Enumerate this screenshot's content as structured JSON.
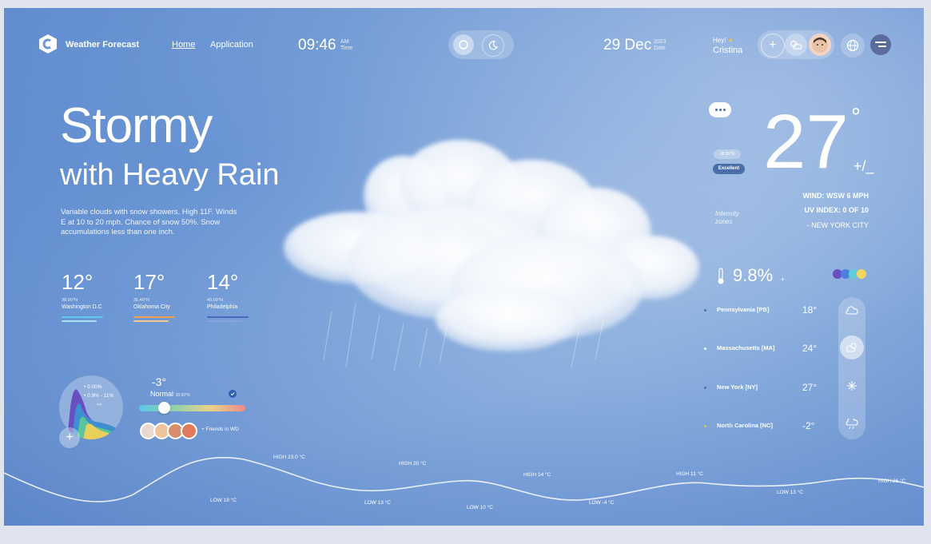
{
  "header": {
    "brand": "Weather Forecast",
    "nav": [
      "Home",
      "Application"
    ],
    "time": "09:46",
    "time_am": "AM",
    "time_label": "Time",
    "date": "29 Dec",
    "year": "2023",
    "date_label": "Date",
    "greeting": "Hey!",
    "user": "Cristina"
  },
  "hero": {
    "title": "Stormy",
    "subtitle": "with Heavy Rain",
    "description": "Variable clouds with snow showers. High 11F. Winds E at 10 to 20 mph. Chance of snow 50%. Snow accumulations less than one inch."
  },
  "cities": [
    {
      "temp": "12°",
      "coord": "38.90°N",
      "name": "Washington D.C",
      "color": "#5fc8f0"
    },
    {
      "temp": "17°",
      "coord": "35.46°N",
      "name": "Oklahoma City",
      "color": "#f0a04c"
    },
    {
      "temp": "14°",
      "coord": "40.00°N",
      "name": "Philadelphia",
      "color": "#4a68b8"
    }
  ],
  "widget": {
    "gauge_value": "0.00%",
    "gauge_range": "0.9% - 11%",
    "temp": "-3°",
    "status": "Normal",
    "coord": "38.90°N",
    "slider_position": 0.2,
    "friends": "+ Friends in WD"
  },
  "current": {
    "temp": "27",
    "degree": "°",
    "plusminus": "+/_",
    "coord": "38.90°N",
    "quality": "Excellent",
    "wind": "WIND: WSW 6 MPH",
    "uv": "UV INDEX: 0 OF 10",
    "location": "- NEW YORK CITY",
    "intensity_label": "Intensity",
    "zones_label": "zones",
    "humidity": "9.8%",
    "humidity_mark": "+"
  },
  "states": [
    {
      "name": "Pennsylvania [PB]",
      "temp": "18°",
      "dot": "#4f6fb8"
    },
    {
      "name": "Massachusetts [MA]",
      "temp": "24°",
      "dot": "#ffffff"
    },
    {
      "name": "New York [NY]",
      "temp": "27°",
      "dot": "#4f6fb8"
    },
    {
      "name": "North Carolina [NC]",
      "temp": "-2°",
      "dot": "#f0c040"
    }
  ],
  "forecast": [
    "LOW 18 °C",
    "HIGH 23.0 °C",
    "LOW 13 °C",
    "HIGH 20 °C",
    "LOW 10 °C",
    "HIGH 14 °C",
    "LOW -4 °C",
    "HIGH 11 °C",
    "LOW 13 °C",
    "HIGH 26 °C"
  ],
  "colors": {
    "accent": "#4a6ea8",
    "sky": "#7ea4da"
  }
}
